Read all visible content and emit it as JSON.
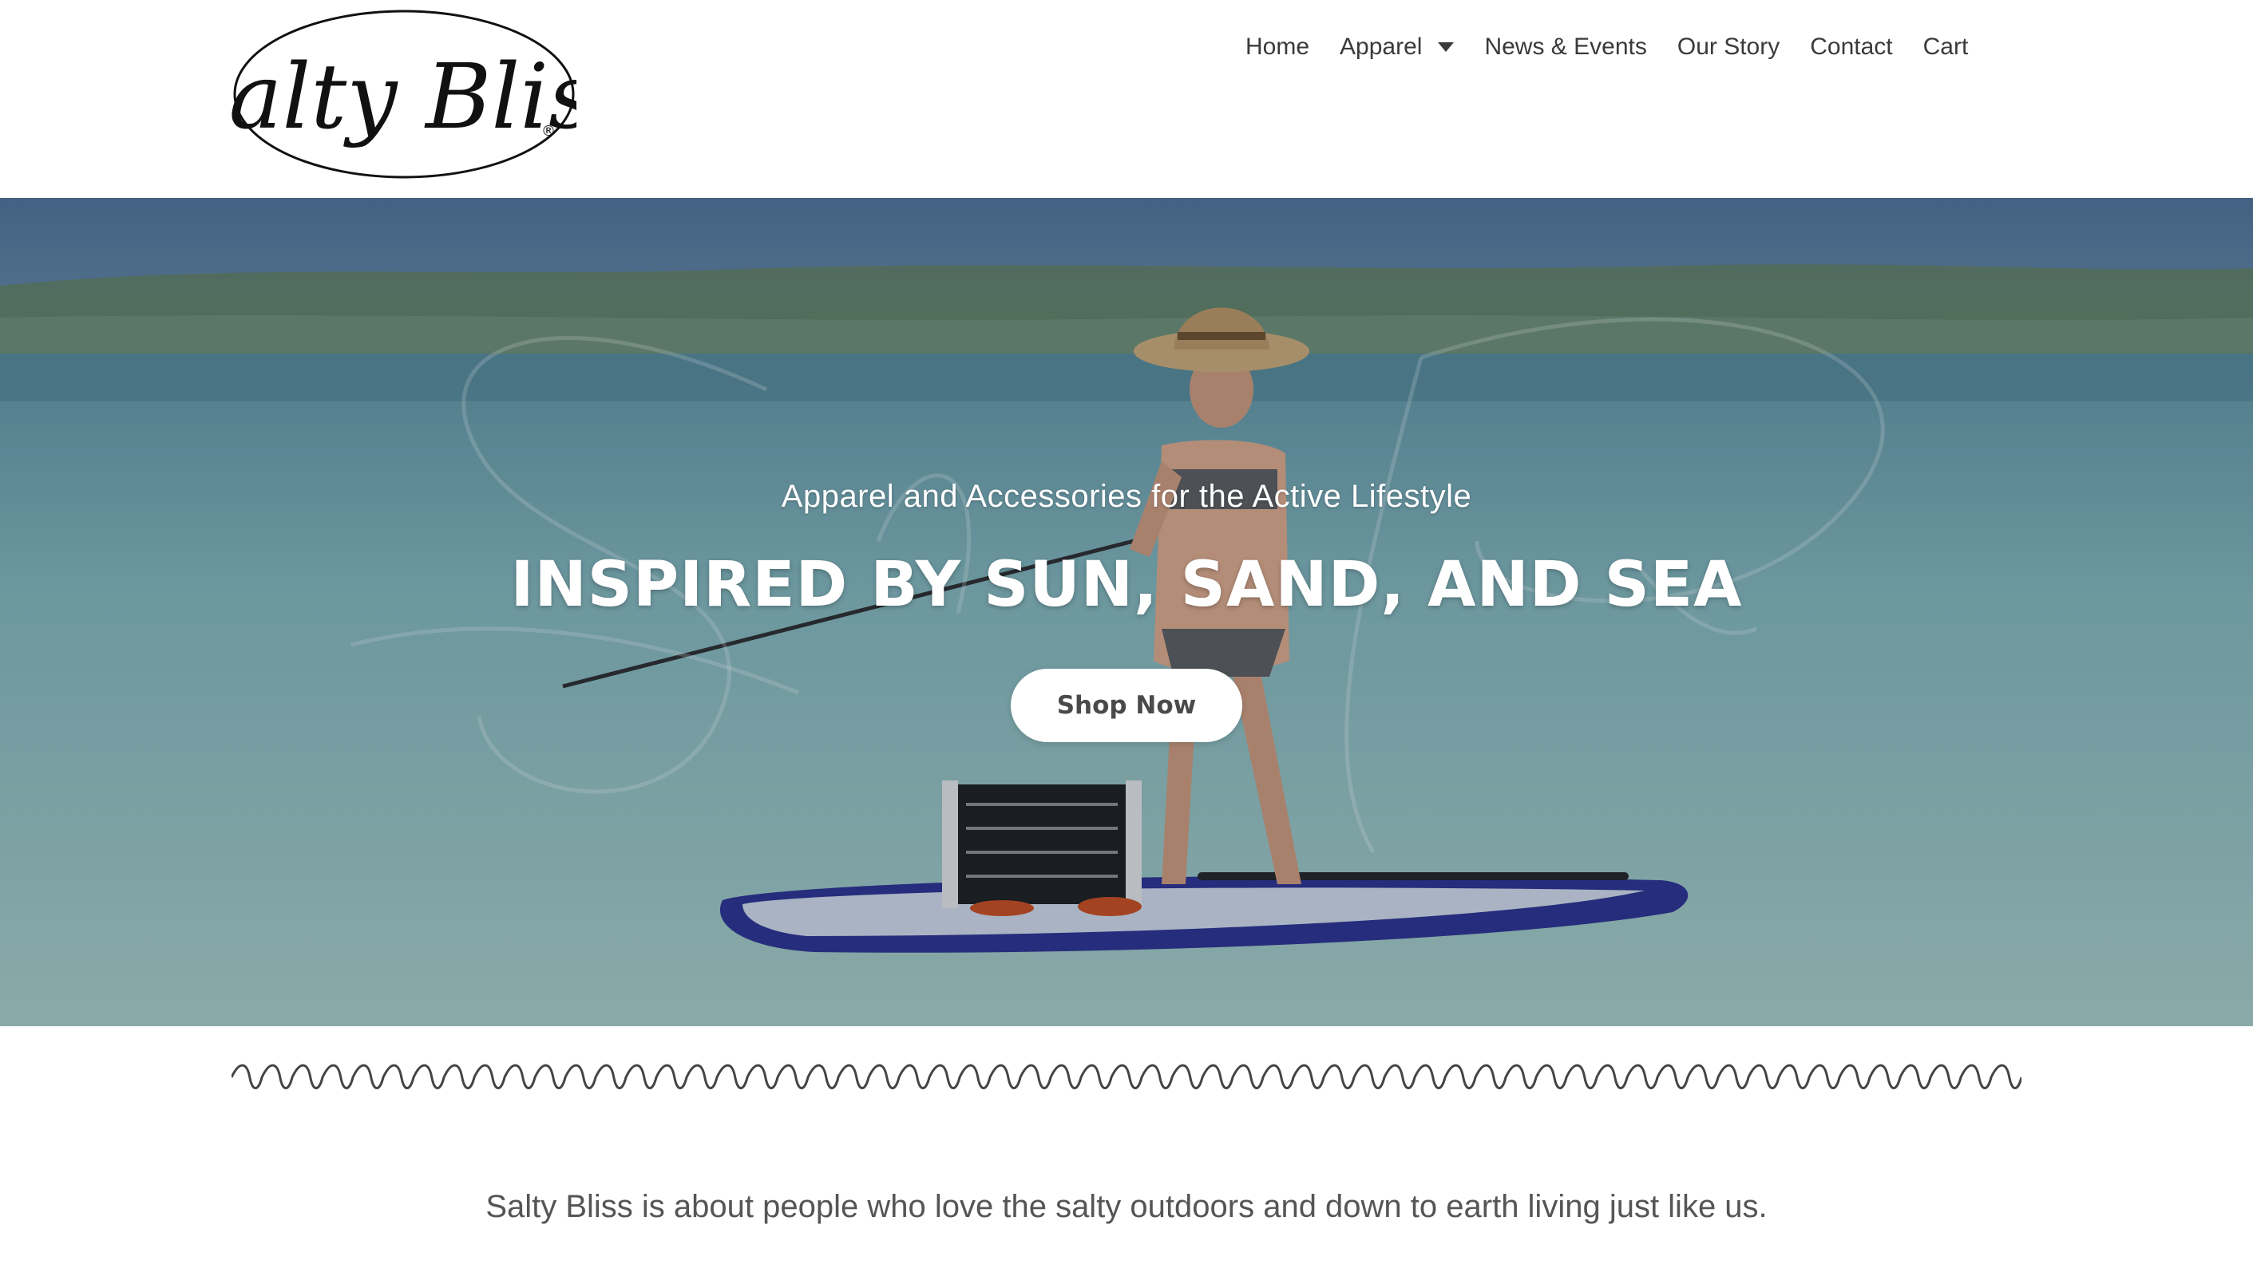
{
  "brand": {
    "logo_text": "Salty Bliss",
    "registered_mark": "®"
  },
  "nav": {
    "items": [
      {
        "label": "Home"
      },
      {
        "label": "Apparel",
        "has_dropdown": true
      },
      {
        "label": "News & Events"
      },
      {
        "label": "Our Story"
      },
      {
        "label": "Contact"
      },
      {
        "label": "Cart"
      }
    ]
  },
  "hero": {
    "subtitle": "Apparel and Accessories for the Active Lifestyle",
    "title": "INSPIRED BY SUN, SAND, AND SEA",
    "cta_label": "Shop Now",
    "watermark_text": "Salty Bliss"
  },
  "intro": {
    "text": "Salty Bliss is about people who love the salty outdoors and down to earth living just like us."
  },
  "colors": {
    "nav_text": "#3a3a3a",
    "hero_text": "#ffffff",
    "button_bg": "#ffffff",
    "button_text": "#4a4a4a",
    "body_text": "#555555",
    "board_blue": "#2a2f8a"
  },
  "icons": {
    "dropdown": "caret-down-icon",
    "divider": "wave-divider"
  }
}
